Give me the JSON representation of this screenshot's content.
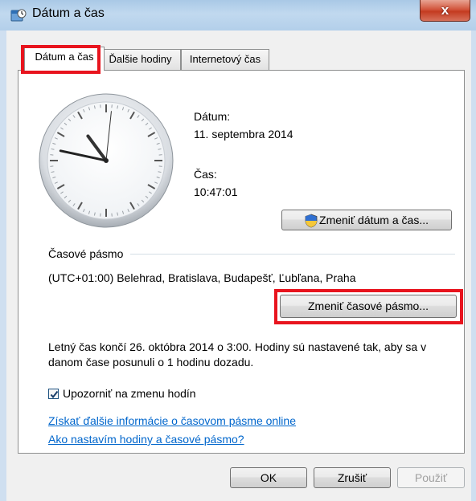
{
  "window": {
    "title": "Dátum a čas",
    "close_glyph": "x"
  },
  "tabs": [
    {
      "label": "Dátum a čas",
      "active": true
    },
    {
      "label": "Ďalšie hodiny",
      "active": false
    },
    {
      "label": "Internetový čas",
      "active": false
    }
  ],
  "date_section": {
    "date_label": "Dátum:",
    "date_value": "11. septembra 2014",
    "time_label": "Čas:",
    "time_value": "10:47:01",
    "change_button": "Zmeniť dátum a čas..."
  },
  "timezone": {
    "heading": "Časové pásmo",
    "value": "(UTC+01:00) Belehrad, Bratislava, Budapešť, Ľubľana, Praha",
    "change_button": "Zmeniť časové pásmo..."
  },
  "dst_note": {
    "line1": "Letný čas končí 26. októbra 2014 o 3:00. Hodiny sú nastavené tak, aby sa v",
    "line2": "danom čase posunuli o 1 hodinu dozadu."
  },
  "notify": {
    "label": "Upozorniť na zmenu hodín",
    "checked": true
  },
  "links": {
    "timezone_info": "Získať ďalšie informácie o časovom pásme online",
    "how_to": "Ako nastavím hodiny a časové pásmo?"
  },
  "buttons": {
    "ok": "OK",
    "cancel": "Zrušiť",
    "apply": "Použiť"
  },
  "clock": {
    "hours": 10,
    "minutes": 47,
    "seconds": 1
  },
  "colors": {
    "highlight": "#e8141e",
    "link": "#0066cc"
  }
}
